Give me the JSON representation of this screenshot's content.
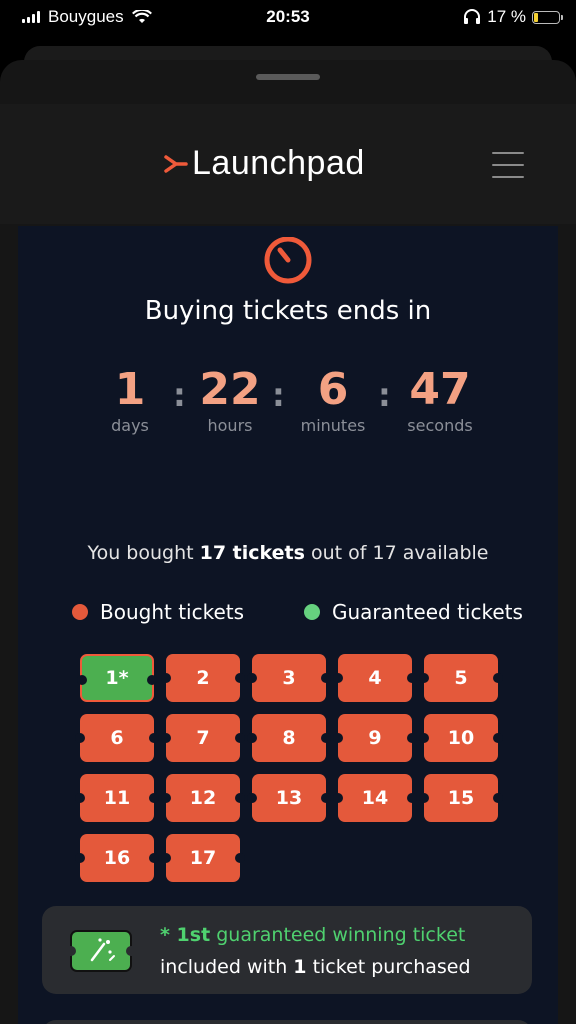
{
  "status_bar": {
    "carrier": "Bouygues",
    "time": "20:53",
    "battery_text": "17 %",
    "battery_level": 0.17
  },
  "header": {
    "logo_text": "Launchpad",
    "menu_icon": "hamburger-menu-icon"
  },
  "timer": {
    "title": "Buying tickets ends in",
    "units": [
      {
        "value": "1",
        "label": "days"
      },
      {
        "value": "22",
        "label": "hours"
      },
      {
        "value": "6",
        "label": "minutes"
      },
      {
        "value": "47",
        "label": "seconds"
      }
    ],
    "separator": ":"
  },
  "summary": {
    "prefix": "You bought ",
    "bold": "17 tickets",
    "suffix": " out of 17 available"
  },
  "legend": {
    "bought_label": "Bought tickets",
    "guaranteed_label": "Guaranteed tickets"
  },
  "tickets": [
    "1*",
    "2",
    "3",
    "4",
    "5",
    "6",
    "7",
    "8",
    "9",
    "10",
    "11",
    "12",
    "13",
    "14",
    "15",
    "16",
    "17"
  ],
  "guaranteed_tickets": [
    "1*"
  ],
  "guarantee_info": {
    "star_ordinal": "* 1st",
    "line1_rest": " guaranteed winning ticket",
    "line2_prefix": "included with ",
    "line2_bold": "1",
    "line2_suffix": " ticket purchased"
  },
  "colors": {
    "accent": "#ef5a3a",
    "ticket_bought": "#e4593b",
    "ticket_guaranteed": "#4caf50",
    "countdown_number": "#f3a183",
    "panel_background": "#0d1424"
  }
}
